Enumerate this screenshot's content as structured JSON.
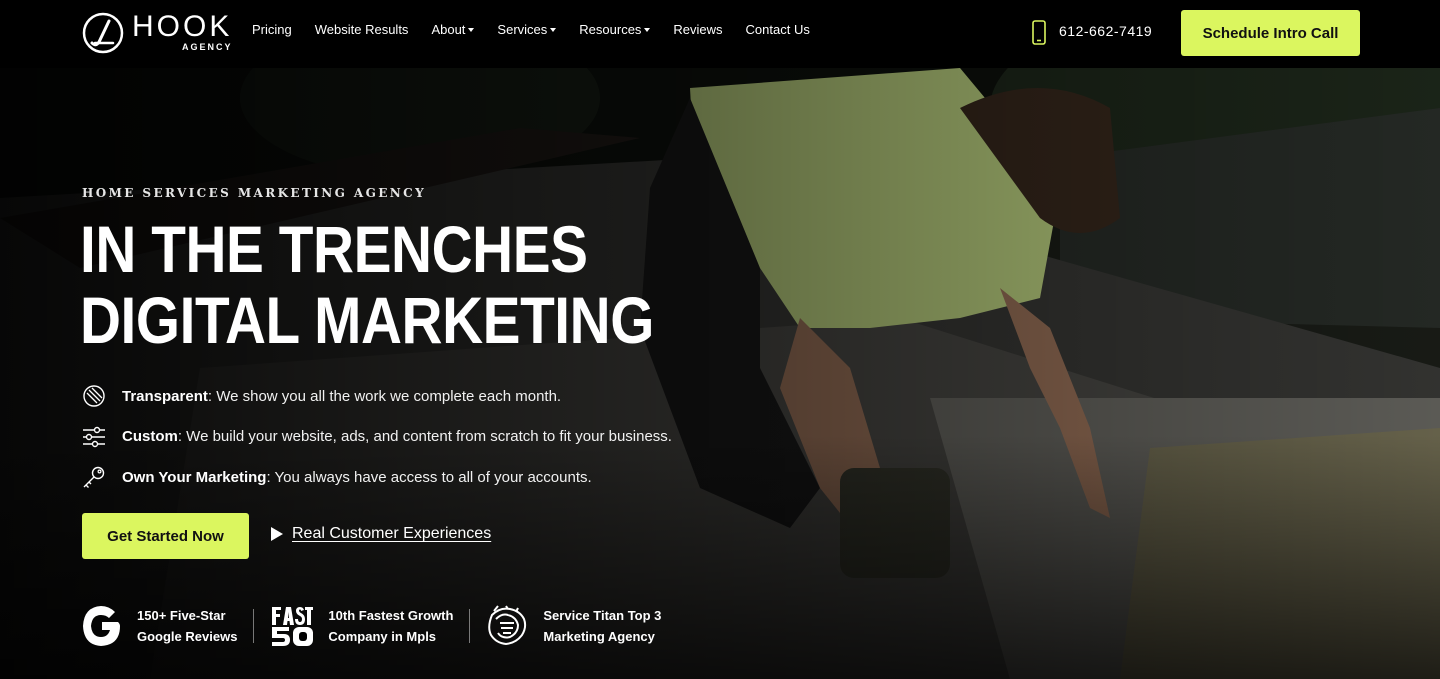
{
  "brand": {
    "name": "HOOK",
    "sub": "AGENCY",
    "accent": "#dbf65f"
  },
  "nav": {
    "items": [
      {
        "label": "Pricing",
        "dropdown": false
      },
      {
        "label": "Website Results",
        "dropdown": false
      },
      {
        "label": "About",
        "dropdown": true
      },
      {
        "label": "Services",
        "dropdown": true
      },
      {
        "label": "Resources",
        "dropdown": true
      },
      {
        "label": "Reviews",
        "dropdown": false
      },
      {
        "label": "Contact Us",
        "dropdown": false
      }
    ],
    "phone": "612-662-7419",
    "phone_icon": "mobile-phone-icon",
    "cta": "Schedule Intro Call"
  },
  "hero": {
    "eyebrow": "HOME SERVICES MARKETING AGENCY",
    "headline": [
      "IN THE TRENCHES",
      "DIGITAL MARKETING"
    ],
    "features": [
      {
        "icon": "transparent-layers-icon",
        "title": "Transparent",
        "text": ": We show you all the work we complete each month."
      },
      {
        "icon": "sliders-icon",
        "title": "Custom",
        "text": ": We build your website, ads, and content from scratch to fit your business."
      },
      {
        "icon": "key-icon",
        "title": "Own Your Marketing",
        "text": ": You always have access to all of your accounts."
      }
    ],
    "primary_button": "Get Started Now",
    "video_link": "Real Customer Experiences",
    "badges": [
      {
        "icon": "google-g-icon",
        "line1": "150+ Five-Star",
        "line2": "Google Reviews"
      },
      {
        "icon": "fast-50-logo",
        "line1": "10th Fastest Growth",
        "line2": "Company in Mpls"
      },
      {
        "icon": "service-titan-logo",
        "line1": "Service Titan Top 3",
        "line2": "Marketing Agency"
      }
    ]
  }
}
